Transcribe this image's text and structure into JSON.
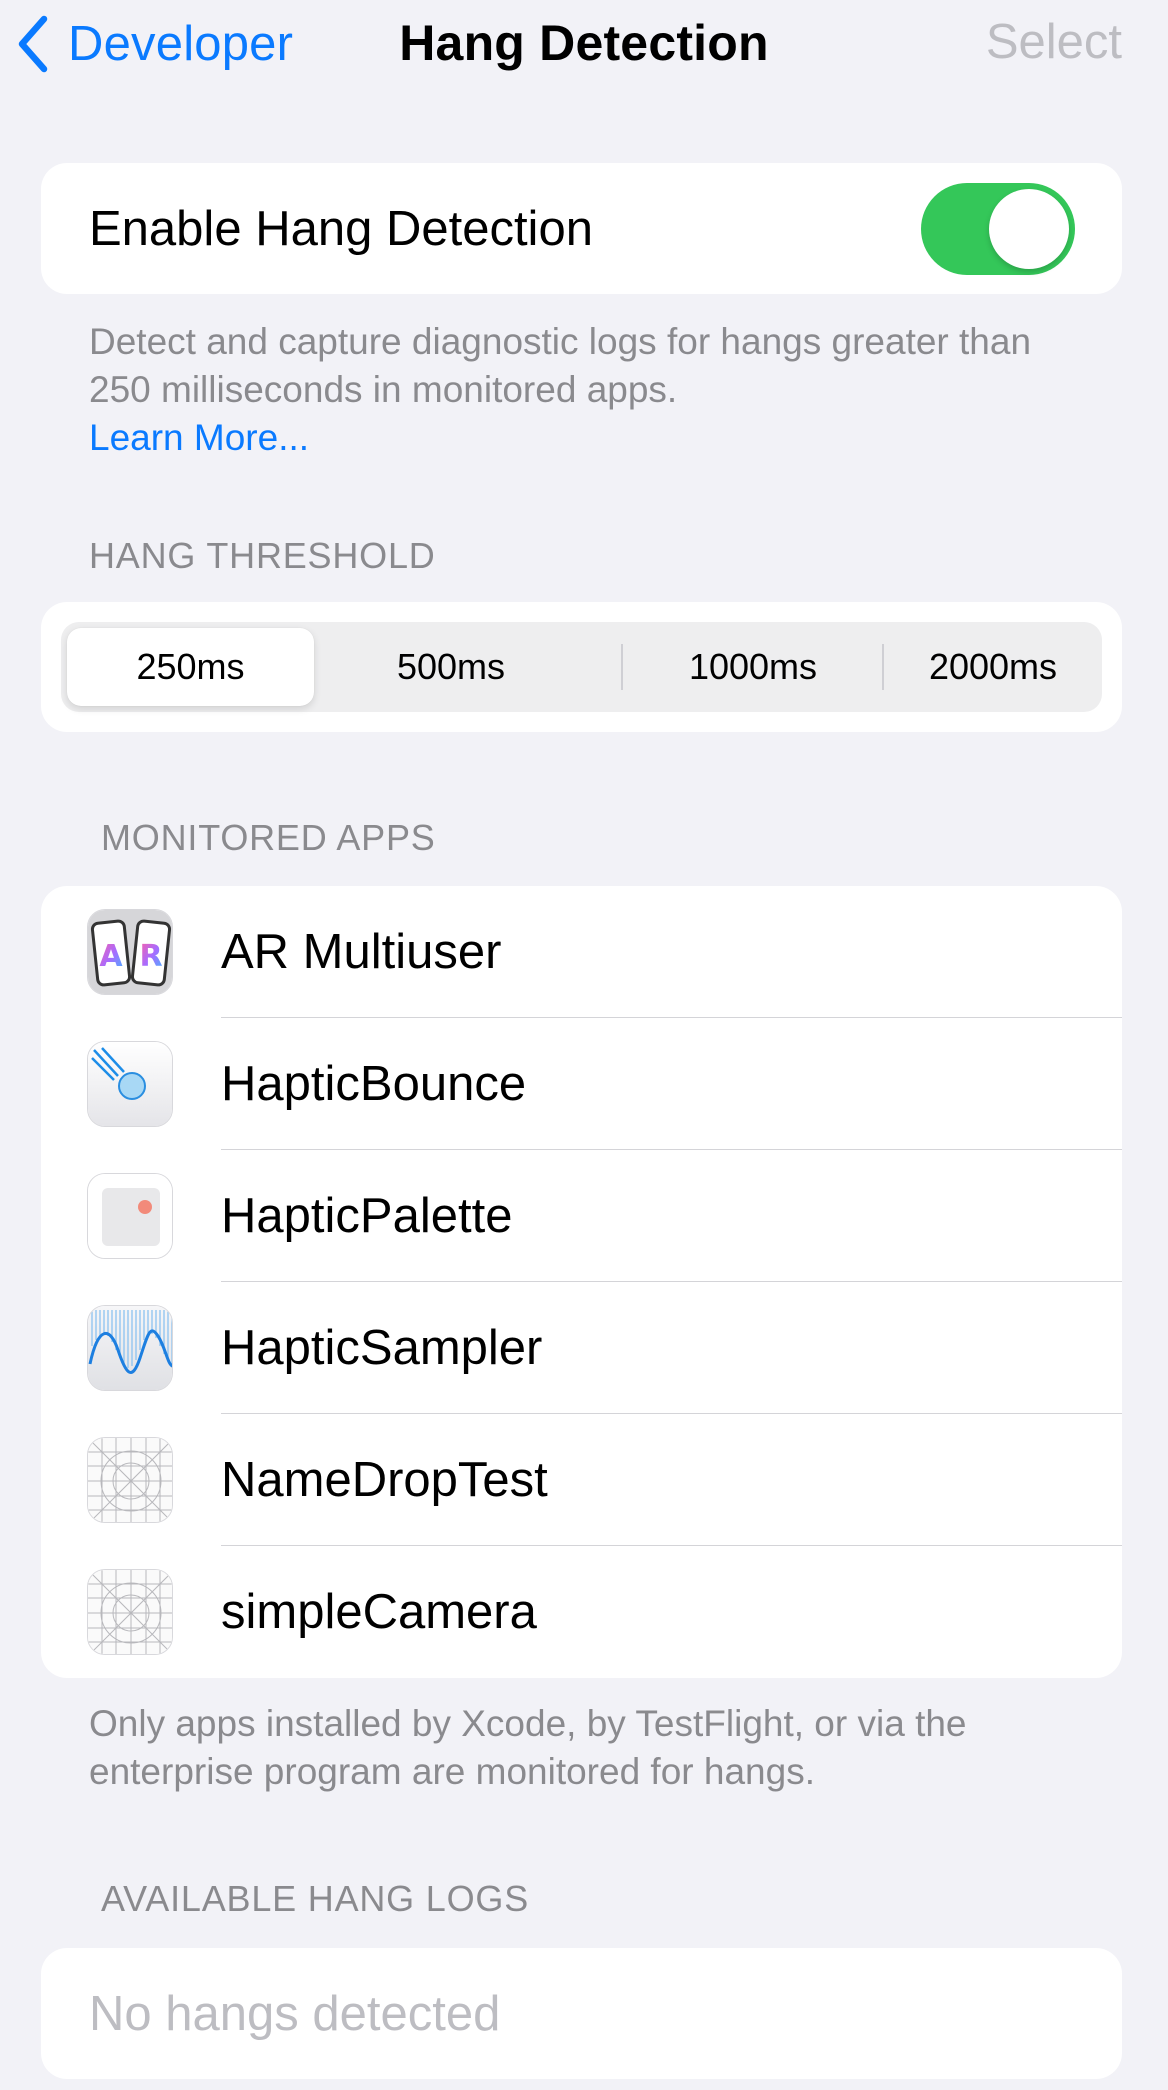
{
  "nav": {
    "back_label": "Developer",
    "title": "Hang Detection",
    "select_label": "Select"
  },
  "toggle": {
    "label": "Enable Hang Detection",
    "on": true
  },
  "toggle_footer": {
    "text": "Detect and capture diagnostic logs for hangs greater than 250 milliseconds in monitored apps.",
    "learn_more": "Learn More..."
  },
  "threshold": {
    "header": "HANG THRESHOLD",
    "options": [
      "250ms",
      "500ms",
      "1000ms",
      "2000ms"
    ],
    "selected": "250ms"
  },
  "monitored": {
    "header": "MONITORED APPS",
    "apps": [
      {
        "name": "AR Multiuser",
        "icon": "ar-multiuser-icon"
      },
      {
        "name": "HapticBounce",
        "icon": "haptic-bounce-icon"
      },
      {
        "name": "HapticPalette",
        "icon": "haptic-palette-icon"
      },
      {
        "name": "HapticSampler",
        "icon": "haptic-sampler-icon"
      },
      {
        "name": "NameDropTest",
        "icon": "placeholder-app-icon"
      },
      {
        "name": "simpleCamera",
        "icon": "placeholder-app-icon"
      }
    ],
    "footer": "Only apps installed by Xcode, by TestFlight, or via the enterprise program are monitored for hangs."
  },
  "logs": {
    "header": "AVAILABLE HANG LOGS",
    "empty": "No hangs detected"
  },
  "colors": {
    "accent": "#0a7aff",
    "switch_on": "#34c759",
    "background": "#f2f2f7",
    "secondary_text": "#8a8a8e"
  }
}
